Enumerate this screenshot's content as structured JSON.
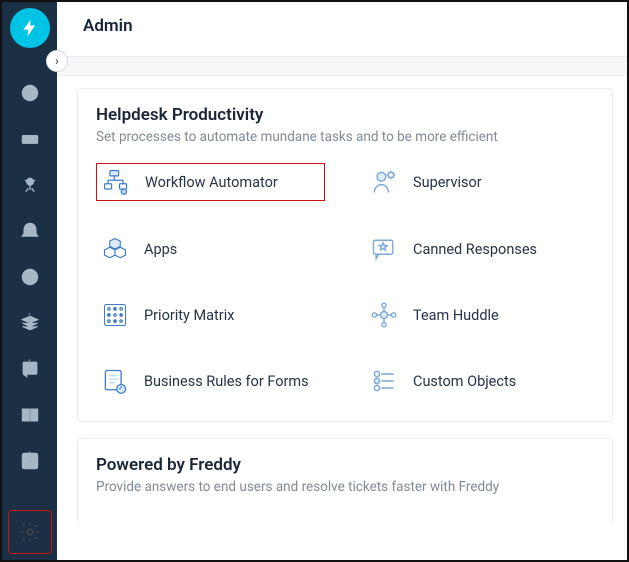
{
  "header": {
    "title": "Admin"
  },
  "sections": {
    "productivity": {
      "title": "Helpdesk Productivity",
      "subtitle": "Set processes to automate mundane tasks and to be more efficient",
      "items": {
        "workflow": {
          "label": "Workflow Automator"
        },
        "supervisor": {
          "label": "Supervisor"
        },
        "apps": {
          "label": "Apps"
        },
        "canned": {
          "label": "Canned Responses"
        },
        "priority": {
          "label": "Priority Matrix"
        },
        "huddle": {
          "label": "Team Huddle"
        },
        "rules": {
          "label": "Business Rules for Forms"
        },
        "custom": {
          "label": "Custom Objects"
        }
      }
    },
    "freddy": {
      "title": "Powered by Freddy",
      "subtitle": "Provide answers to end users and resolve tickets faster with Freddy"
    }
  }
}
